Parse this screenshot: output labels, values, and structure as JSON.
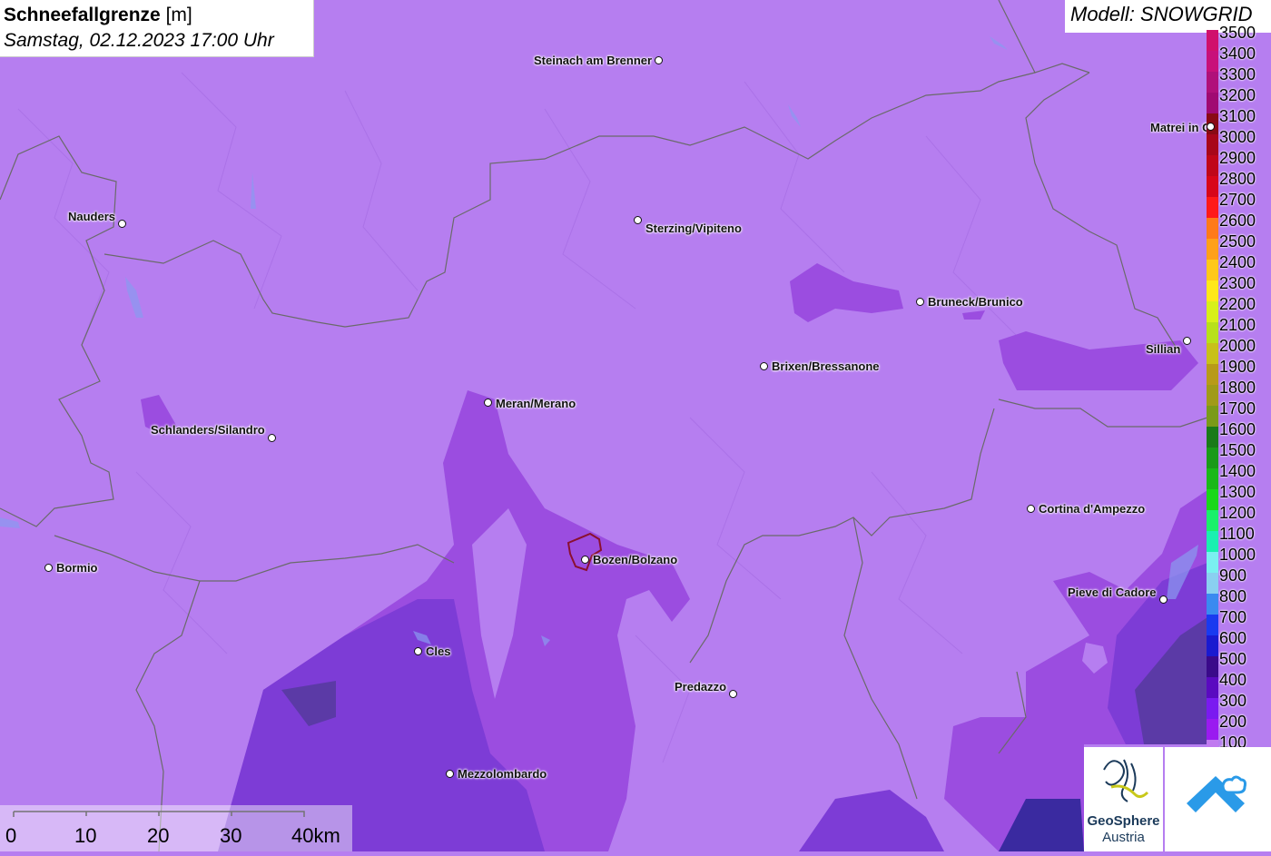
{
  "title": {
    "param": "Schneefallgrenze",
    "unit": "[m]",
    "datetime": "Samstag, 02.12.2023 17:00 Uhr"
  },
  "model": "Modell: SNOWGRID",
  "legend": {
    "labels": [
      "3500",
      "3400",
      "3300",
      "3200",
      "3100",
      "3000",
      "2900",
      "2800",
      "2700",
      "2600",
      "2500",
      "2400",
      "2300",
      "2200",
      "2100",
      "2000",
      "1900",
      "1800",
      "1700",
      "1600",
      "1500",
      "1400",
      "1300",
      "1200",
      "1100",
      "1000",
      "900",
      "800",
      "700",
      "600",
      "500",
      "400",
      "300",
      "200",
      "100"
    ],
    "colors": [
      "#d0106c",
      "#c8107a",
      "#b0107a",
      "#a00a72",
      "#8a0a14",
      "#a8061a",
      "#c0061a",
      "#d8061a",
      "#ff1a1a",
      "#ff7a1a",
      "#ffa01a",
      "#ffc81a",
      "#ffe81a",
      "#d8f01a",
      "#b8e01a",
      "#c8c01a",
      "#b89a1a",
      "#a09a1a",
      "#7a9a1a",
      "#1a7a1a",
      "#1a9a1a",
      "#1ab81a",
      "#1ad81a",
      "#1af06a",
      "#1af0b0",
      "#7af0f0",
      "#8ad0f0",
      "#3a8af0",
      "#1a3af0",
      "#1a1ad0",
      "#3a0a8a",
      "#5a0ac0",
      "#7a1af0",
      "#9a1af0",
      "#c07af0"
    ]
  },
  "cities": [
    {
      "name": "Steinach am Brenner",
      "label_side": "left"
    },
    {
      "name": "Nauders",
      "label_side": "left"
    },
    {
      "name": "Sterzing/Vipiteno",
      "label_side": "right"
    },
    {
      "name": "Matrei in Osttirol",
      "label_side": "right"
    },
    {
      "name": "Bruneck/Brunico",
      "label_side": "right"
    },
    {
      "name": "Sillian",
      "label_side": "left"
    },
    {
      "name": "Brixen/Bressanone",
      "label_side": "right"
    },
    {
      "name": "Meran/Merano",
      "label_side": "right"
    },
    {
      "name": "Schlanders/Silandro",
      "label_side": "left"
    },
    {
      "name": "Cortina d'Ampezzo",
      "label_side": "right"
    },
    {
      "name": "Bormio",
      "label_side": "right"
    },
    {
      "name": "Bozen/Bolzano",
      "label_side": "right"
    },
    {
      "name": "Pieve di Cadore",
      "label_side": "left"
    },
    {
      "name": "Cles",
      "label_side": "right"
    },
    {
      "name": "Predazzo",
      "label_side": "left"
    },
    {
      "name": "Mezzolombardo",
      "label_side": "right"
    }
  ],
  "scale": {
    "labels": [
      "0",
      "10",
      "20",
      "30",
      "40km"
    ]
  },
  "logos": {
    "geosphere_line1": "GeoSphere",
    "geosphere_line2": "Austria"
  },
  "colors": {
    "base_fill": "#b67ef0",
    "low_fill": "#9b4de0",
    "lower_fill": "#7d3cd6",
    "lowest_fill": "#6a3ad0",
    "border": "#6a6a6a"
  }
}
